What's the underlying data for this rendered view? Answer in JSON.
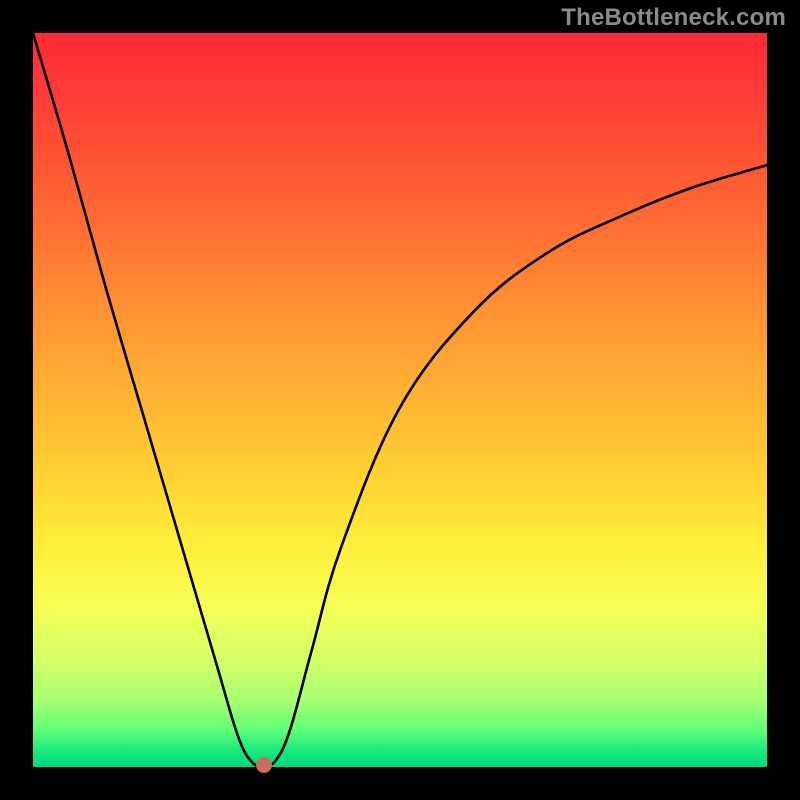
{
  "watermark": "TheBottleneck.com",
  "colors": {
    "frame_bg": "#000000",
    "watermark_text": "#8a8a8a",
    "curve_stroke": "#000000",
    "dot_fill": "#cf6a5f",
    "gradient_top": "#ff2a33",
    "gradient_bottom": "#00d880"
  },
  "chart_data": {
    "type": "line",
    "title": "",
    "xlabel": "",
    "ylabel": "",
    "xlim": [
      0,
      100
    ],
    "ylim": [
      0,
      100
    ],
    "grid": false,
    "series": [
      {
        "name": "curve",
        "x": [
          0,
          5,
          10,
          15,
          20,
          25,
          28,
          30,
          31.5,
          33,
          35,
          38,
          42,
          50,
          60,
          70,
          80,
          90,
          100
        ],
        "y": [
          100,
          83,
          65,
          48,
          31,
          14,
          4,
          0.5,
          0.3,
          0.8,
          5,
          16,
          30,
          49,
          62,
          70,
          75,
          79,
          82
        ]
      }
    ],
    "annotations": [
      {
        "name": "minimum-marker",
        "x": 31.5,
        "y": 0.3
      }
    ]
  }
}
